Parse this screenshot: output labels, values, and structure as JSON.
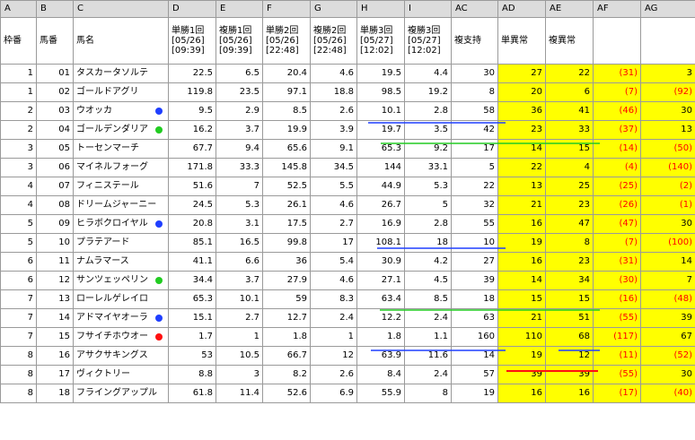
{
  "columns": [
    "A",
    "B",
    "C",
    "D",
    "E",
    "F",
    "G",
    "H",
    "I",
    "AC",
    "AD",
    "AE",
    "AF",
    "AG"
  ],
  "headers": [
    [
      "枠番"
    ],
    [
      "馬番"
    ],
    [
      "馬名"
    ],
    [
      "単勝1回",
      "[05/26]",
      "[09:39]"
    ],
    [
      "複勝1回",
      "[05/26]",
      "[09:39]"
    ],
    [
      "単勝2回",
      "[05/26]",
      "[22:48]"
    ],
    [
      "複勝2回",
      "[05/26]",
      "[22:48]"
    ],
    [
      "単勝3回",
      "[05/27]",
      "[12:02]"
    ],
    [
      "複勝3回",
      "[05/27]",
      "[12:02]"
    ],
    [
      "複支持"
    ],
    [
      "単異常"
    ],
    [
      "複異常"
    ],
    [
      ""
    ],
    [
      ""
    ]
  ],
  "rows": [
    [
      "1",
      "01",
      "タスカータソルテ",
      "22.5",
      "6.5",
      "20.4",
      "4.6",
      "19.5",
      "4.4",
      "30",
      "27",
      "22",
      "(31)",
      "3"
    ],
    [
      "1",
      "02",
      "ゴールドアグリ",
      "119.8",
      "23.5",
      "97.1",
      "18.8",
      "98.5",
      "19.2",
      "8",
      "20",
      "6",
      "(7)",
      "(92)"
    ],
    [
      "2",
      "03",
      "ウオッカ",
      "9.5",
      "2.9",
      "8.5",
      "2.6",
      "10.1",
      "2.8",
      "58",
      "36",
      "41",
      "(46)",
      "30"
    ],
    [
      "2",
      "04",
      "ゴールデンダリア",
      "16.2",
      "3.7",
      "19.9",
      "3.9",
      "19.7",
      "3.5",
      "42",
      "23",
      "33",
      "(37)",
      "13"
    ],
    [
      "3",
      "05",
      "トーセンマーチ",
      "67.7",
      "9.4",
      "65.6",
      "9.1",
      "65.3",
      "9.2",
      "17",
      "14",
      "15",
      "(14)",
      "(50)"
    ],
    [
      "3",
      "06",
      "マイネルフォーグ",
      "171.8",
      "33.3",
      "145.8",
      "34.5",
      "144",
      "33.1",
      "5",
      "22",
      "4",
      "(4)",
      "(140)"
    ],
    [
      "4",
      "07",
      "フィニステール",
      "51.6",
      "7",
      "52.5",
      "5.5",
      "44.9",
      "5.3",
      "22",
      "13",
      "25",
      "(25)",
      "(2)"
    ],
    [
      "4",
      "08",
      "ドリームジャーニー",
      "24.5",
      "5.3",
      "26.1",
      "4.6",
      "26.7",
      "5",
      "32",
      "21",
      "23",
      "(26)",
      "(1)"
    ],
    [
      "5",
      "09",
      "ヒラボクロイヤル",
      "20.8",
      "3.1",
      "17.5",
      "2.7",
      "16.9",
      "2.8",
      "55",
      "16",
      "47",
      "(47)",
      "30"
    ],
    [
      "5",
      "10",
      "プラテアード",
      "85.1",
      "16.5",
      "99.8",
      "17",
      "108.1",
      "18",
      "10",
      "19",
      "8",
      "(7)",
      "(100)"
    ],
    [
      "6",
      "11",
      "ナムラマース",
      "41.1",
      "6.6",
      "36",
      "5.4",
      "30.9",
      "4.2",
      "27",
      "16",
      "23",
      "(31)",
      "14"
    ],
    [
      "6",
      "12",
      "サンツェッペリン",
      "34.4",
      "3.7",
      "27.9",
      "4.6",
      "27.1",
      "4.5",
      "39",
      "14",
      "34",
      "(30)",
      "7"
    ],
    [
      "7",
      "13",
      "ローレルゲレイロ",
      "65.3",
      "10.1",
      "59",
      "8.3",
      "63.4",
      "8.5",
      "18",
      "15",
      "15",
      "(16)",
      "(48)"
    ],
    [
      "7",
      "14",
      "アドマイヤオーラ",
      "15.1",
      "2.7",
      "12.7",
      "2.4",
      "12.2",
      "2.4",
      "63",
      "21",
      "51",
      "(55)",
      "39"
    ],
    [
      "7",
      "15",
      "フサイチホウオー",
      "1.7",
      "1",
      "1.8",
      "1",
      "1.8",
      "1.1",
      "160",
      "110",
      "68",
      "(117)",
      "67"
    ],
    [
      "8",
      "16",
      "アサクサキングス",
      "53",
      "10.5",
      "66.7",
      "12",
      "63.9",
      "11.6",
      "14",
      "19",
      "12",
      "(11)",
      "(52)"
    ],
    [
      "8",
      "17",
      "ヴィクトリー",
      "8.8",
      "3",
      "8.2",
      "2.6",
      "8.4",
      "2.4",
      "57",
      "39",
      "39",
      "(55)",
      "30"
    ],
    [
      "8",
      "18",
      "フライングアップル",
      "61.8",
      "11.4",
      "52.6",
      "6.9",
      "55.9",
      "8",
      "19",
      "16",
      "16",
      "(17)",
      "(40)"
    ]
  ],
  "marks": {
    "2": "#1f3fff",
    "3": "#22cc22",
    "8": "#1f3fff",
    "11": "#22cc22",
    "13": "#1f3fff",
    "14": "#ff1010"
  },
  "colors": {
    "yellow_fill": "#ffff00",
    "negative_text": "#ff0000",
    "blue_mark": "#1f3fff",
    "green_mark": "#22cc22",
    "red_mark": "#ff1010"
  }
}
